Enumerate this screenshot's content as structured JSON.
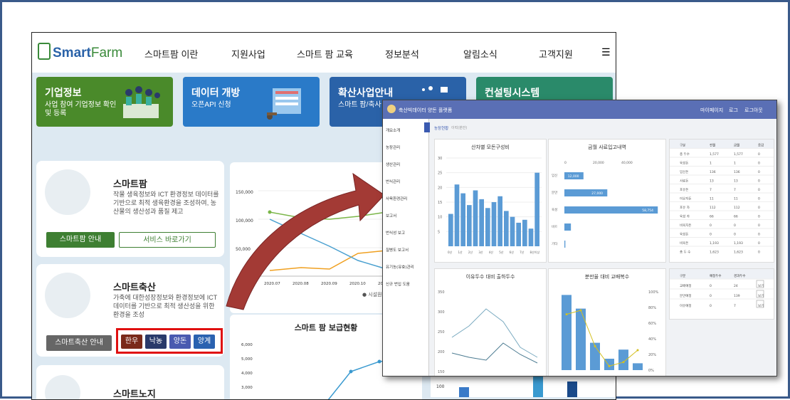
{
  "site": {
    "logo": {
      "prefix": "Smart",
      "suffix": "Farm"
    },
    "nav": [
      "스마트팜 이란",
      "지원사업",
      "스마트 팜 교육",
      "정보분석",
      "알림소식",
      "고객지원"
    ],
    "menu_icon": "hamburger-icon",
    "banners": [
      {
        "title": "기업정보",
        "desc": "사업 참여 기업정보 확인 및 등록"
      },
      {
        "title": "데이터 개방",
        "desc": "오픈API 신청"
      },
      {
        "title": "확산사업안내",
        "desc": "스마트 팜/축사 안내"
      },
      {
        "title": "컨설팅시스템",
        "desc": ""
      }
    ],
    "cards": [
      {
        "title": "스마트팜",
        "desc": "작물 생육정보와 ICT 환경정보 데이터를 기반으로 최적 생육환경을 조성하여, 농산물의 생산성과 품질 제고",
        "btn1": "스마트팜 안내",
        "btn2": "서비스 바로가기"
      },
      {
        "title": "스마트축산",
        "desc": "가축에 대한성장정보와 환경정보에 ICT 데이터를 기반으로 최적 생산성을 위한 환경을 조성",
        "btn1": "스마트축산 안내",
        "pills": [
          "한우",
          "낙농",
          "양돈",
          "양계"
        ]
      },
      {
        "title": "스마트노지"
      }
    ],
    "line_chart": {
      "y_ticks": [
        "150,000",
        "100,000",
        "50,000"
      ],
      "x_ticks": [
        "2020.07",
        "2020.08",
        "2020.09",
        "2020.10",
        "2020.11"
      ],
      "legend": "● 시설원"
    },
    "supply_chart": {
      "title": "스마트 팜 보급현황",
      "y_ticks": [
        "6,000",
        "5,000",
        "4,000",
        "3,000"
      ]
    },
    "side_bar_label": "100"
  },
  "dashboard": {
    "title": "축산빅데이터 양돈 플랫폼",
    "top_links": [
      "마이페이지",
      "로그",
      "로그아웃"
    ],
    "breadcrumb": "농장현황",
    "breadcrumb_sub": "이력(분만)",
    "menu": [
      "개요소개",
      "농장관리",
      "생산관리",
      "번식관리",
      "사육환경관리",
      "보고서",
      "번식성 보고",
      "질병도 보고서",
      "유기농(유효)관리",
      "신규 번입 도움"
    ],
    "panels": [
      {
        "title": "산차별 모돈구성비"
      },
      {
        "title": "금월 사료입고내역"
      },
      {
        "title": "이유두수 대비 출하두수"
      },
      {
        "title": "분만율 대비 교배복수"
      }
    ],
    "hbar": {
      "axis": [
        "0",
        "20,000",
        "40,000"
      ],
      "labels": [
        "임신",
        "분만",
        "육성",
        "비육",
        "기타"
      ],
      "values": [
        12000,
        27000,
        58754,
        4100,
        600
      ],
      "value_labels": [
        "12,000",
        "27,000",
        "58,754",
        "4,100",
        ""
      ]
    },
    "vbar": {
      "y_ticks": [
        "30",
        "25",
        "20",
        "15",
        "10",
        "5"
      ],
      "values": [
        11,
        21,
        18,
        14,
        19,
        16,
        13,
        15,
        17,
        12,
        10,
        8,
        9,
        6,
        25
      ],
      "x_ticks": [
        "0산",
        "1산",
        "2산",
        "3산",
        "4산",
        "5산",
        "6산",
        "7산",
        "8산이상"
      ]
    },
    "line_panel": {
      "y_ticks": [
        "350",
        "300",
        "250",
        "200",
        "150"
      ]
    },
    "combo_panel": {
      "y_right": [
        "100%",
        "80%",
        "60%",
        "40%",
        "20%",
        "0%"
      ],
      "bars": [
        33,
        27,
        12,
        5,
        9,
        3
      ],
      "line": [
        70,
        75,
        30,
        5,
        10,
        25
      ]
    },
    "table1": {
      "headers": [
        "구분",
        "전월",
        "금월",
        "증감"
      ],
      "rows": [
        [
          "총 두수",
          "1,577",
          "1,577",
          "0"
        ],
        [
          "육성돈",
          "1",
          "1",
          "0"
        ],
        [
          "임신돈",
          "136",
          "136",
          "0"
        ],
        [
          "사료돈",
          "13",
          "13",
          "0"
        ],
        [
          "포유돈",
          "7",
          "7",
          "0"
        ],
        [
          "이유자돈",
          "11",
          "11",
          "0"
        ],
        [
          "포유 자",
          "112",
          "112",
          "0"
        ],
        [
          "육성 자",
          "66",
          "66",
          "0"
        ],
        [
          "비육자돈",
          "0",
          "0",
          "0"
        ],
        [
          "육성돈",
          "0",
          "0",
          "0"
        ],
        [
          "비육돈",
          "1,193",
          "1,193",
          "0"
        ],
        [
          "총 두 수",
          "1,623",
          "1,623",
          "0"
        ]
      ]
    },
    "table2": {
      "headers": [
        "구분",
        "예정두수",
        "경과두수",
        ""
      ],
      "rows": [
        [
          "교배예정",
          "0",
          "24",
          "보기"
        ],
        [
          "분만예정",
          "0",
          "139",
          "보기"
        ],
        [
          "이유예정",
          "0",
          "7",
          "보기"
        ]
      ]
    }
  },
  "colors": {
    "frame": "#3a5a8a",
    "arrow": "#a03030",
    "red_box": "#e01010",
    "green": "#3e7f32",
    "dash_header": "#5a6fb5",
    "bar_blue": "#5b9bd5"
  }
}
